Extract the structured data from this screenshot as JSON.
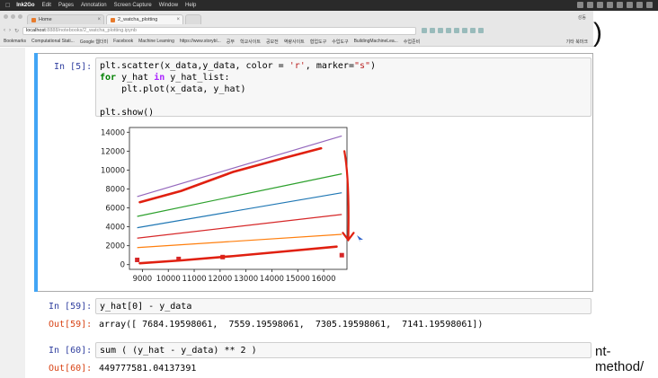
{
  "menubar": {
    "app": "Ink2Go",
    "items": [
      "Edit",
      "Pages",
      "Annotation",
      "Screen Capture",
      "Window",
      "Help"
    ]
  },
  "browser": {
    "tabs": [
      {
        "label": "Home"
      },
      {
        "label": "2_watcha_plotting"
      }
    ],
    "profile_label": "성동",
    "url_host": "localhost",
    "url_path": ":8888/notebooks/2_watcha_plotting.ipynb",
    "bookmarks": [
      "Bookmarks",
      "Computational Stati...",
      "Google 웹더미",
      "Facebook",
      "Machine Learning",
      "https://www.storybl...",
      "공부",
      "학교사이트",
      "공모전",
      "역량사이트",
      "협업도구",
      "수업도구",
      "BuildingMachineLea...",
      "수업준비"
    ],
    "bookmarks_other": "기타 북마크"
  },
  "cells": [
    {
      "prompt": "In [5]:",
      "code_lines": [
        "plt.scatter(x_data,y_data, color = 'r', marker=\"s\")",
        "for y_hat in y_hat_list:",
        "    plt.plot(x_data, y_hat)",
        "",
        "plt.show()"
      ]
    },
    {
      "prompt": "In [59]:",
      "code": "y_hat[0] - y_data",
      "out_prompt": "Out[59]:",
      "output": "array([ 7684.19598061,  7559.19598061,  7305.19598061,  7141.19598061])"
    },
    {
      "prompt": "In [60]:",
      "code": "sum ( (y_hat - y_data) ** 2 )",
      "out_prompt": "Out[60]:",
      "output": "449777581.04137391"
    }
  ],
  "side_text": {
    "paren": ")",
    "method": "nt-method/"
  },
  "chart_data": {
    "type": "scatter",
    "x_ticks": [
      9000,
      10000,
      11000,
      12000,
      13000,
      14000,
      15000,
      16000
    ],
    "y_ticks": [
      0,
      2000,
      4000,
      6000,
      8000,
      10000,
      12000,
      14000
    ],
    "xlim": [
      8500,
      16900
    ],
    "ylim": [
      -500,
      14500
    ],
    "scatter": {
      "color": "#d62728",
      "marker": "s",
      "x": [
        8800,
        10400,
        12100,
        16700
      ],
      "y": [
        500,
        600,
        800,
        1000
      ]
    },
    "lines": [
      {
        "color": "#9467bd",
        "x": [
          8800,
          16700
        ],
        "y": [
          7200,
          13600
        ]
      },
      {
        "color": "#2ca02c",
        "x": [
          8800,
          16700
        ],
        "y": [
          5100,
          9600
        ]
      },
      {
        "color": "#1f77b4",
        "x": [
          8800,
          16700
        ],
        "y": [
          3900,
          7600
        ]
      },
      {
        "color": "#d62728",
        "x": [
          8800,
          16700
        ],
        "y": [
          2800,
          5300
        ]
      },
      {
        "color": "#ff7f0e",
        "x": [
          8800,
          16700
        ],
        "y": [
          1800,
          3200
        ]
      }
    ],
    "annotations": {
      "color": "#e02010",
      "upper_stroke": {
        "x": [
          8900,
          10500,
          12500,
          14500,
          15900
        ],
        "y": [
          6600,
          7800,
          9800,
          11300,
          12300
        ]
      },
      "lower_stroke": {
        "x": [
          8900,
          10500,
          12500,
          14500,
          16500
        ],
        "y": [
          150,
          450,
          900,
          1400,
          1900
        ]
      },
      "arrow": {
        "x": [
          16800,
          17000,
          16950
        ],
        "y": [
          12000,
          9000,
          2600
        ]
      }
    }
  }
}
